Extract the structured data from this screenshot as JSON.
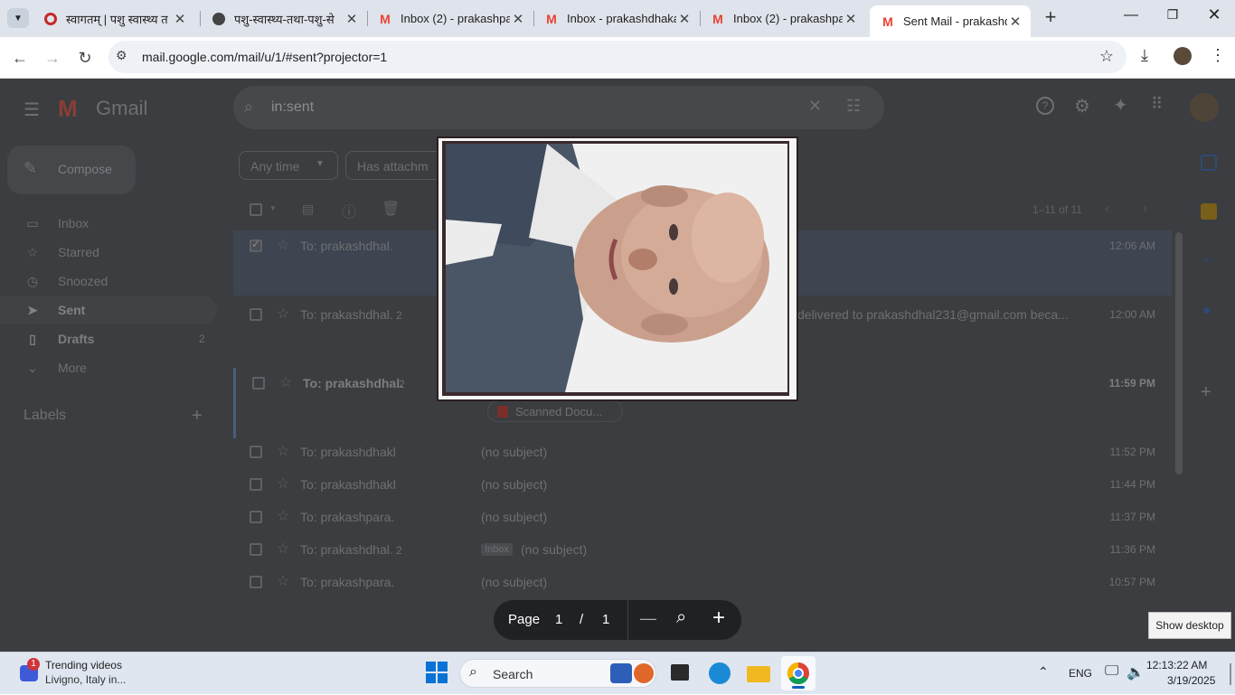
{
  "browser": {
    "tabs": [
      {
        "title": "स्वागतम् | पशु स्वास्थ्य त",
        "icon": "site-favicon-icon",
        "active": false
      },
      {
        "title": "पशु-स्वास्थ्य-तथा-पशु-से",
        "icon": "globe-icon",
        "active": false
      },
      {
        "title": "Inbox (2) - prakashpa",
        "icon": "gmail-icon",
        "active": false
      },
      {
        "title": "Inbox - prakashdhaka",
        "icon": "gmail-icon",
        "active": false
      },
      {
        "title": "Inbox (2) - prakashpa",
        "icon": "gmail-icon",
        "active": false
      },
      {
        "title": "Sent Mail - prakashdh",
        "icon": "gmail-icon",
        "active": true
      }
    ],
    "url": "mail.google.com/mail/u/1/#sent?projector=1"
  },
  "gmail": {
    "logo_text": "Gmail",
    "search_value": "in:sent",
    "compose_label": "Compose",
    "filters": {
      "any_time": "Any time",
      "has_attachment": "Has attachm"
    },
    "pagination": "1–11 of 11",
    "nav": [
      {
        "label": "Inbox",
        "icon": "inbox-icon",
        "count": ""
      },
      {
        "label": "Starred",
        "icon": "star-icon",
        "count": ""
      },
      {
        "label": "Snoozed",
        "icon": "clock-icon",
        "count": ""
      },
      {
        "label": "Sent",
        "icon": "send-icon",
        "count": ""
      },
      {
        "label": "Drafts",
        "icon": "draft-icon",
        "count": "2"
      },
      {
        "label": "More",
        "icon": "chevron-down-icon",
        "count": ""
      }
    ],
    "labels_heading": "Labels",
    "emails": [
      {
        "to": "To: prakashdhal.",
        "count": "",
        "subject": "",
        "time": "12:06 AM",
        "selected": true
      },
      {
        "to": "To: prakashdhal.",
        "count": "2",
        "subject": "delivered to prakashdhal231@gmail.com beca...",
        "time": "12:00 AM",
        "selected": false
      },
      {
        "to": "To: prakashdhal.",
        "count": "2",
        "subject": "",
        "time": "11:59 PM",
        "selected": false,
        "attachment": "Scanned Docu..."
      },
      {
        "to": "To: prakashdhakl",
        "count": "",
        "subject": "(no subject)",
        "time": "11:52 PM",
        "selected": false
      },
      {
        "to": "To: prakashdhakl",
        "count": "",
        "subject": "(no subject)",
        "time": "11:44 PM",
        "selected": false
      },
      {
        "to": "To: prakashpara.",
        "count": "",
        "subject": "(no subject)",
        "time": "11:37 PM",
        "selected": false
      },
      {
        "to": "To: prakashdhal.",
        "count": "2",
        "subject": "(no subject)",
        "label": "Inbox",
        "time": "11:36 PM",
        "selected": false
      },
      {
        "to": "To: prakashpara.",
        "count": "",
        "subject": "(no subject)",
        "time": "10:57 PM",
        "selected": false
      }
    ]
  },
  "viewer": {
    "page_label": "Page",
    "current_page": "1",
    "separator": "/",
    "total_pages": "1"
  },
  "taskbar": {
    "widget_title": "Trending videos",
    "widget_sub": "Livigno, Italy in...",
    "widget_badge": "1",
    "search_placeholder": "Search",
    "lang": "ENG",
    "time": "12:13:22 AM",
    "date": "3/19/2025",
    "tooltip": "Show desktop"
  },
  "colors": {
    "accent": "#0b57d0",
    "gmail_red": "#ea4335",
    "overlay": "#3b3d40"
  }
}
